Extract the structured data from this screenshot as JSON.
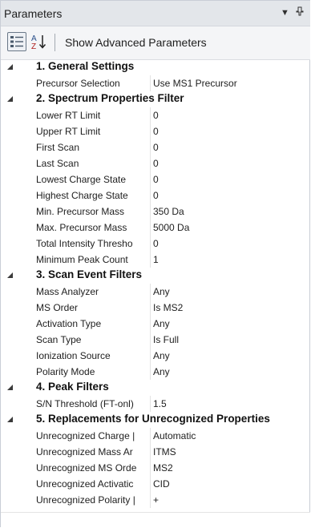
{
  "panel": {
    "title": "Parameters",
    "dropdown_glyph": "▼",
    "pin_glyph": "ᵠ",
    "show_advanced_label": "Show Advanced Parameters"
  },
  "icons": {
    "categorized": "categorized-view-icon",
    "alphabetical": "sort-az-icon",
    "expander": "expander-triangle-icon"
  },
  "categories": [
    {
      "label": "1. General Settings",
      "props": [
        {
          "name": "Precursor Selection",
          "value": "Use MS1 Precursor"
        }
      ]
    },
    {
      "label": "2. Spectrum Properties Filter",
      "props": [
        {
          "name": "Lower RT Limit",
          "value": "0"
        },
        {
          "name": "Upper RT Limit",
          "value": "0"
        },
        {
          "name": "First Scan",
          "value": "0"
        },
        {
          "name": "Last Scan",
          "value": "0"
        },
        {
          "name": "Lowest Charge State",
          "value": "0"
        },
        {
          "name": "Highest Charge State",
          "value": "0"
        },
        {
          "name": "Min. Precursor Mass",
          "value": "350 Da"
        },
        {
          "name": "Max. Precursor Mass",
          "value": "5000 Da"
        },
        {
          "name": "Total Intensity Thresho",
          "value": "0"
        },
        {
          "name": "Minimum Peak Count",
          "value": "1"
        }
      ]
    },
    {
      "label": "3. Scan Event Filters",
      "props": [
        {
          "name": "Mass Analyzer",
          "value": "Any"
        },
        {
          "name": "MS Order",
          "value": "Is MS2"
        },
        {
          "name": "Activation Type",
          "value": "Any"
        },
        {
          "name": "Scan Type",
          "value": "Is Full"
        },
        {
          "name": "Ionization Source",
          "value": "Any"
        },
        {
          "name": "Polarity Mode",
          "value": "Any"
        }
      ]
    },
    {
      "label": "4. Peak Filters",
      "props": [
        {
          "name": "S/N Threshold (FT-onl)",
          "value": "1.5"
        }
      ]
    },
    {
      "label": "5. Replacements for Unrecognized Properties",
      "props": [
        {
          "name": "Unrecognized Charge |",
          "value": "Automatic"
        },
        {
          "name": "Unrecognized Mass Ar",
          "value": "ITMS"
        },
        {
          "name": "Unrecognized MS Orde",
          "value": "MS2"
        },
        {
          "name": "Unrecognized Activatic",
          "value": "CID"
        },
        {
          "name": "Unrecognized Polarity |",
          "value": "+"
        }
      ]
    }
  ]
}
